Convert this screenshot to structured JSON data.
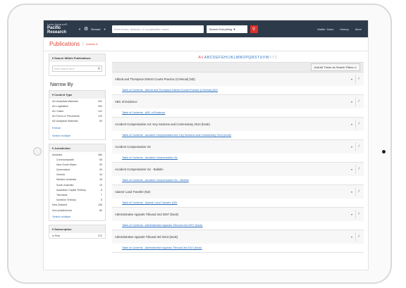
{
  "topbar": {
    "brand_line1": "Lexis Advance®",
    "brand_line2": "Pacific Research",
    "browse": "Browse",
    "search_placeholder": "Enter terms, citations, or a publication name",
    "search_scope": "Search Everything",
    "nav": [
      "Matter: None",
      "History",
      "More"
    ]
  },
  "subheader": {
    "title": "Publications",
    "actions": "Actions"
  },
  "left": {
    "search_panel_title": "Search Within Publications",
    "search_placeholder": "Enter search term",
    "narrow_by": "Narrow By",
    "content_type_title": "Content Type",
    "content_type": [
      {
        "label": "AU Analytical Materials",
        "count": "341"
      },
      {
        "label": "AU Legislation",
        "count": "394"
      },
      {
        "label": "AU Cases",
        "count": "141"
      },
      {
        "label": "AU Forms & Precedents",
        "count": "120"
      },
      {
        "label": "NZ Analytical Materials",
        "count": "90"
      }
    ],
    "more": "More",
    "select_multiple": "Select multiple",
    "jurisdiction_title": "Jurisdiction",
    "jurisdiction": [
      {
        "label": "Australia",
        "count": "380",
        "indent": false
      },
      {
        "label": "Commonwealth",
        "count": "55",
        "indent": true
      },
      {
        "label": "New South Wales",
        "count": "90",
        "indent": true
      },
      {
        "label": "Queensland",
        "count": "30",
        "indent": true
      },
      {
        "label": "Victoria",
        "count": "34",
        "indent": true
      },
      {
        "label": "Western Australia",
        "count": "16",
        "indent": true
      },
      {
        "label": "South Australia",
        "count": "10",
        "indent": true
      },
      {
        "label": "Australian Capital Territory",
        "count": "8",
        "indent": true
      },
      {
        "label": "Tasmania",
        "count": "7",
        "indent": true
      },
      {
        "label": "Northern Territory",
        "count": "5",
        "indent": true
      },
      {
        "label": "New Zealand",
        "count": "155",
        "indent": false
      },
      {
        "label": "Non-jurisdictional",
        "count": "80",
        "indent": false
      }
    ],
    "select_multiple2": "Select multiple",
    "subscription_title": "Subscription",
    "subscription": [
      {
        "label": "In Plan",
        "count": "372"
      }
    ]
  },
  "main": {
    "alpha_all": "All",
    "alpha_letters": [
      "A",
      "B",
      "C",
      "D",
      "E",
      "F",
      "G",
      "H",
      "I",
      "J",
      "K",
      "L",
      "M",
      "N",
      "O",
      "P",
      "Q",
      "R",
      "S",
      "T",
      "U",
      "V",
      "W",
      "X",
      "Y",
      "Z"
    ],
    "alpha_disabled": [
      "X",
      "Y",
      "Z"
    ],
    "add_all": "Add All These as Search Filters",
    "items": [
      {
        "title": "Abbott and Thompson District Courts Practice (Criminal) (NZ)",
        "toc": "Table of Contents - Abbott and Thompson District Courts Practice (Criminal) (NZ)"
      },
      {
        "title": "ABC of Evidence",
        "toc": "Table of Contents - ABC of Evidence"
      },
      {
        "title": "Accident Compensation Act: Key Sections and Commentary 2014 (book)",
        "toc": "Table of Contents - Accident Compensation Act: Key Sections and Commentary 2014 (book)"
      },
      {
        "title": "Accident Compensation Vic",
        "toc": "Table of Contents - Accident Compensation Vic"
      },
      {
        "title": "Accident Compensation Vic - Bulletin",
        "toc": "Table of Contents - Accident Compensation Vic - Bulletin"
      },
      {
        "title": "Adams' Land Transfer (NZ)",
        "toc": "Table of Contents - Adams' Land Transfer (NZ)"
      },
      {
        "title": "Administrative Appeals Tribunal 2nd 2007 (book)",
        "toc": "Table of Contents - Administrative Appeals Tribunal 2nd 2007 (book)"
      },
      {
        "title": "Administrative Appeals Tribunal 3rd 2013 (book)",
        "toc": "Table of Contents - Administrative Appeals Tribunal 3rd 2013 (book)"
      }
    ]
  }
}
